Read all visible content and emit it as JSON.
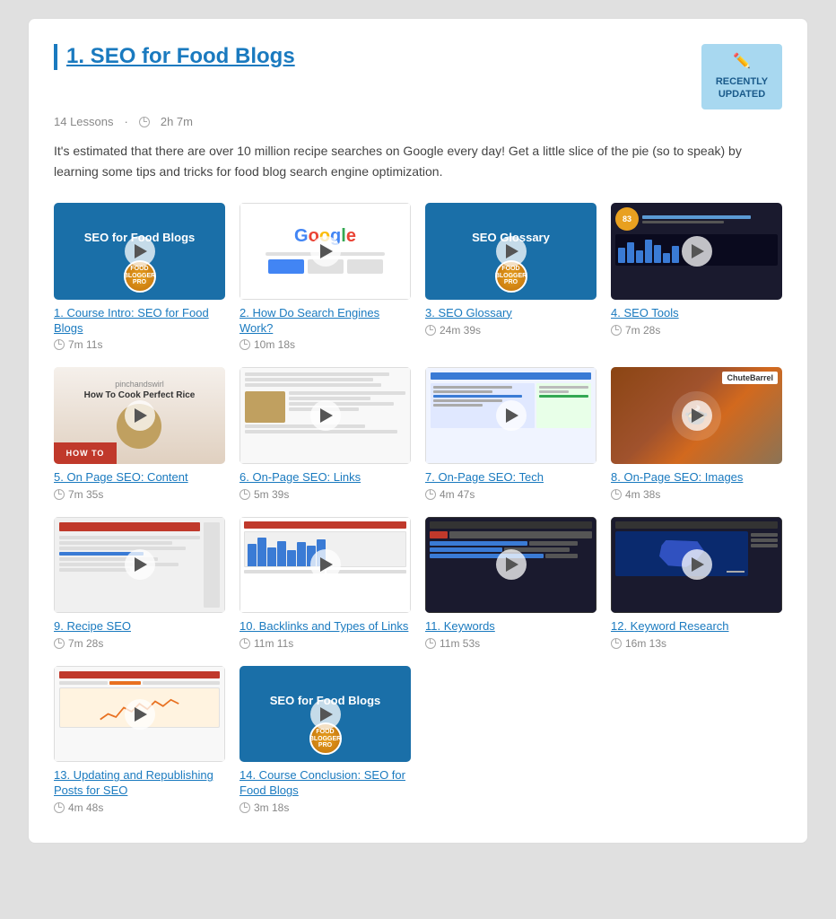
{
  "course": {
    "title": "1. SEO for Food Blogs",
    "lessons_count": "14 Lessons",
    "duration": "2h 7m",
    "recently_updated": "RECENTLY\nUPDATED",
    "description": "It's estimated that there are over 10 million recipe searches on Google every day! Get a little slice of the pie (so to speak) by learning some tips and tricks for food blog search engine optimization.",
    "lessons": [
      {
        "id": 1,
        "title": "1. Course Intro: SEO for Food Blogs",
        "duration": "7m 11s",
        "thumb_type": "blue_label",
        "thumb_text": "SEO for Food Blogs",
        "has_badge": true
      },
      {
        "id": 2,
        "title": "2. How Do Search Engines Work?",
        "duration": "10m 18s",
        "thumb_type": "google",
        "thumb_text": "",
        "has_badge": false
      },
      {
        "id": 3,
        "title": "3. SEO Glossary",
        "duration": "24m 39s",
        "thumb_type": "blue_label",
        "thumb_text": "SEO Glossary",
        "has_badge": true
      },
      {
        "id": 4,
        "title": "4. SEO Tools",
        "duration": "7m 28s",
        "thumb_type": "seo_tools",
        "thumb_text": "",
        "has_badge": false
      },
      {
        "id": 5,
        "title": "5. On Page SEO: Content",
        "duration": "7m 35s",
        "thumb_type": "howto",
        "thumb_text": "",
        "has_badge": false
      },
      {
        "id": 6,
        "title": "6. On-Page SEO: Links",
        "duration": "5m 39s",
        "thumb_type": "links",
        "thumb_text": "",
        "has_badge": false
      },
      {
        "id": 7,
        "title": "7. On-Page SEO: Tech",
        "duration": "4m 47s",
        "thumb_type": "tech",
        "thumb_text": "",
        "has_badge": false
      },
      {
        "id": 8,
        "title": "8. On-Page SEO: Images",
        "duration": "4m 38s",
        "thumb_type": "food_image",
        "thumb_text": "",
        "has_badge": false
      },
      {
        "id": 9,
        "title": "9. Recipe SEO",
        "duration": "7m 28s",
        "thumb_type": "analytics",
        "thumb_text": "",
        "has_badge": false
      },
      {
        "id": 10,
        "title": "10. Backlinks and Types of Links",
        "duration": "11m 11s",
        "thumb_type": "backlinks",
        "thumb_text": "",
        "has_badge": false
      },
      {
        "id": 11,
        "title": "11. Keywords",
        "duration": "11m 53s",
        "thumb_type": "keywords",
        "thumb_text": "",
        "has_badge": false
      },
      {
        "id": 12,
        "title": "12. Keyword Research",
        "duration": "16m 13s",
        "thumb_type": "map",
        "thumb_text": "",
        "has_badge": false
      },
      {
        "id": 13,
        "title": "13. Updating and Republishing Posts for SEO",
        "duration": "4m 48s",
        "thumb_type": "orange_wave",
        "thumb_text": "",
        "has_badge": false
      },
      {
        "id": 14,
        "title": "14. Course Conclusion: SEO for Food Blogs",
        "duration": "3m 18s",
        "thumb_type": "blue_label",
        "thumb_text": "SEO for Food Blogs",
        "has_badge": true
      }
    ]
  }
}
